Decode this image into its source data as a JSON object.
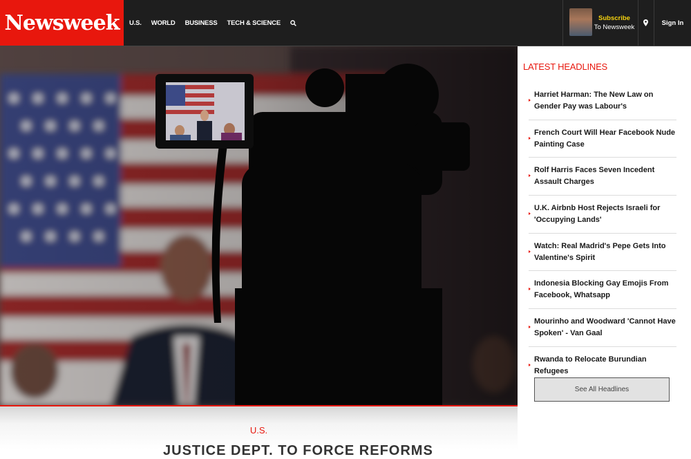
{
  "header": {
    "logo": "Newsweek",
    "nav": [
      "U.S.",
      "WORLD",
      "BUSINESS",
      "TECH & SCIENCE"
    ],
    "search_icon": "search-icon",
    "subscribe_line1": "Subscribe",
    "subscribe_line2": "To Newsweek",
    "location_icon": "map-pin-icon",
    "sign_in": "Sign In"
  },
  "hero": {
    "kicker": "U.S.",
    "headline": "JUSTICE DEPT. TO FORCE REFORMS"
  },
  "sidebar": {
    "title": "LATEST HEADLINES",
    "headlines": [
      "Harriet Harman: The New Law on Gender Pay was Labour's",
      "French Court Will Hear Facebook Nude Painting Case",
      "Rolf Harris Faces Seven Incedent Assault Charges",
      "U.K. Airbnb Host Rejects Israeli for 'Occupying Lands'",
      "Watch: Real Madrid's Pepe Gets Into Valentine's Spirit",
      "Indonesia Blocking Gay Emojis From Facebook, Whatsapp",
      "Mourinho and Woodward 'Cannot Have Spoken' - Van Gaal",
      "Rwanda to Relocate Burundian Refugees"
    ],
    "see_all": "See All Headlines"
  },
  "colors": {
    "brand_red": "#e8170d",
    "header_bg": "#1e1e1e",
    "subscribe_yellow": "#f5d20f"
  }
}
